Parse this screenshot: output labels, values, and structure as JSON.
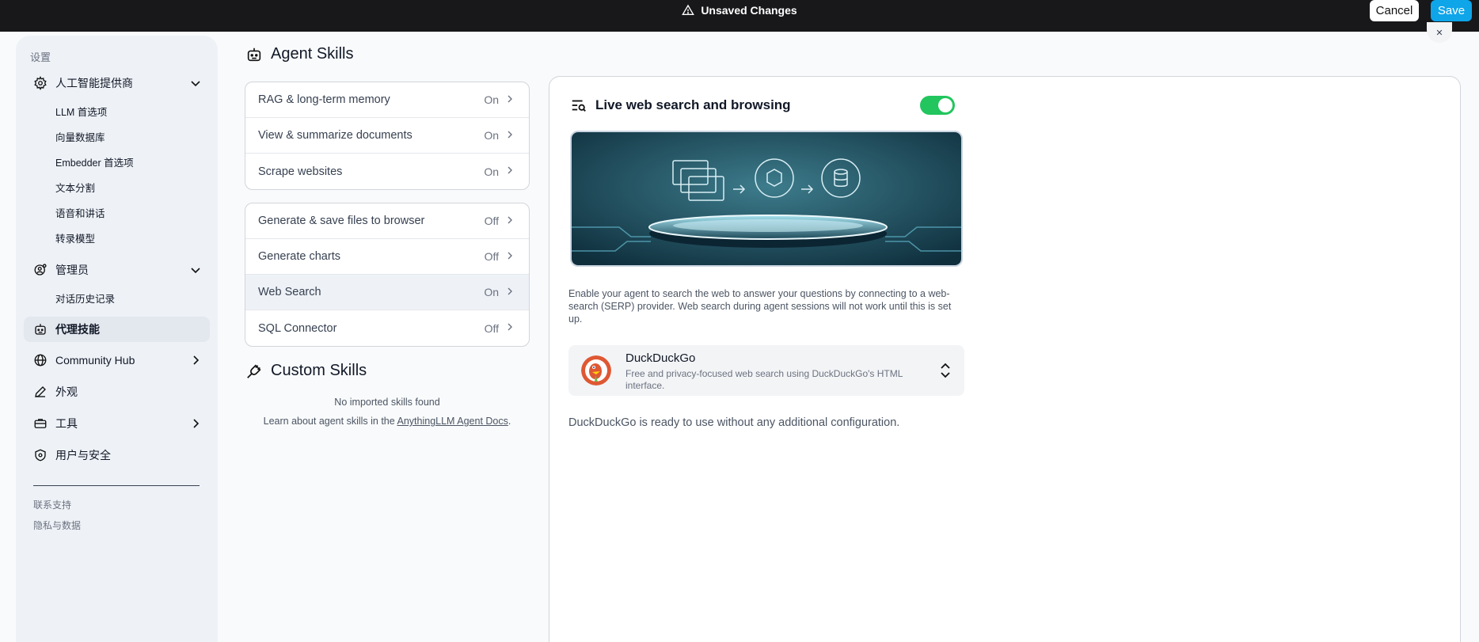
{
  "topbar": {
    "unsaved_label": "Unsaved Changes",
    "cancel_label": "Cancel",
    "save_label": "Save",
    "save_color": "#0ea5e9"
  },
  "sidebar": {
    "title": "设置",
    "groups": [
      {
        "label": "人工智能提供商",
        "icon": "gear-icon",
        "expanded": true,
        "items": [
          "LLM 首选项",
          "向量数据库",
          "Embedder 首选项",
          "文本分割",
          "语音和讲话",
          "转录模型"
        ]
      },
      {
        "label": "管理员",
        "icon": "user-gear-icon",
        "expanded": true,
        "items": [
          "对话历史记录"
        ]
      }
    ],
    "agent_skills": "代理技能",
    "community_hub": "Community Hub",
    "appearance": "外观",
    "tools": "工具",
    "users_security": "用户与安全",
    "footer": [
      "联系支持",
      "隐私与数据"
    ]
  },
  "skills": {
    "heading": "Agent Skills",
    "default_group": [
      {
        "label": "RAG & long-term memory",
        "status": "On"
      },
      {
        "label": "View & summarize documents",
        "status": "On"
      },
      {
        "label": "Scrape websites",
        "status": "On"
      }
    ],
    "configurable_group": [
      {
        "label": "Generate & save files to browser",
        "status": "Off"
      },
      {
        "label": "Generate charts",
        "status": "Off"
      },
      {
        "label": "Web Search",
        "status": "On",
        "selected": true
      },
      {
        "label": "SQL Connector",
        "status": "Off"
      }
    ]
  },
  "custom_skills": {
    "heading": "Custom Skills",
    "empty": "No imported skills found",
    "learn_prefix": "Learn about agent skills in the ",
    "learn_link": "AnythingLLM Agent Docs",
    "learn_suffix": "."
  },
  "panel": {
    "title": "Live web search and browsing",
    "enabled": true,
    "toggle_color": "#22c55e",
    "description": "Enable your agent to search the web to answer your questions by connecting to a web-search (SERP) provider. Web search during agent sessions will not work until this is set up.",
    "provider": {
      "name": "DuckDuckGo",
      "description": "Free and privacy-focused web search using DuckDuckGo's HTML interface.",
      "logo_color": "#de5833"
    },
    "ready_text": "DuckDuckGo is ready to use without any additional configuration."
  }
}
